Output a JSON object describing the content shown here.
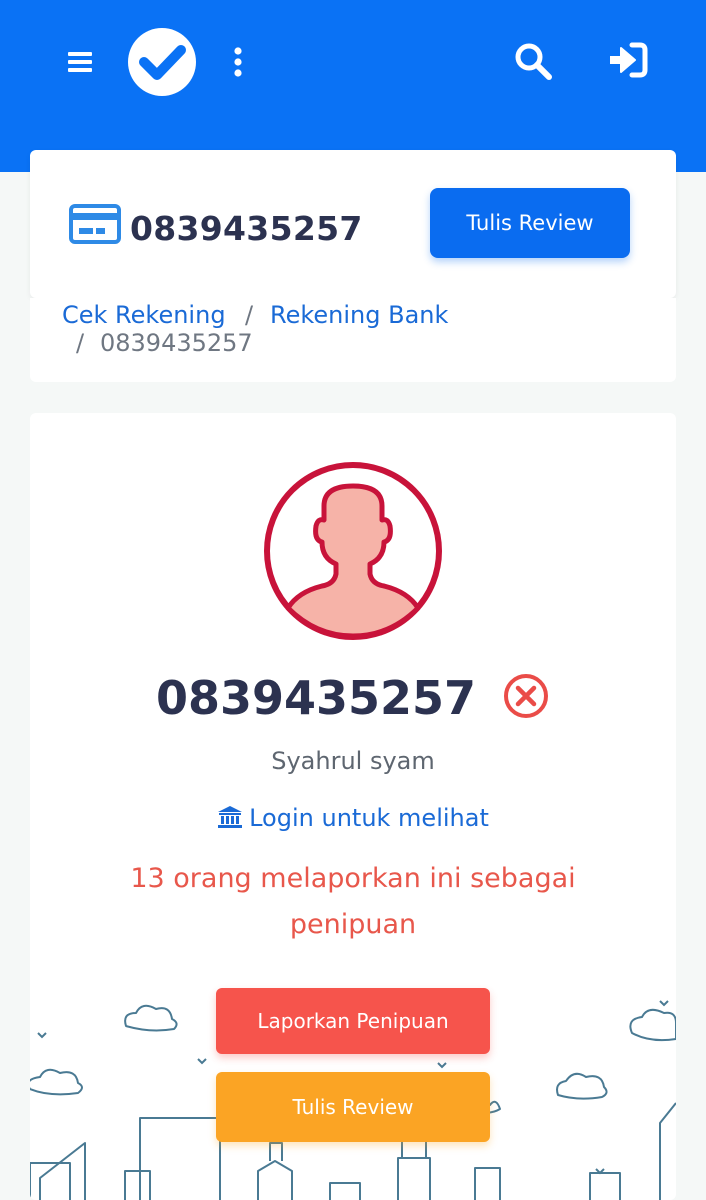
{
  "header": {
    "menu_icon": "hamburger-icon",
    "logo_icon": "check-circle-logo",
    "more_icon": "vertical-dots-icon",
    "search_icon": "search-icon",
    "login_icon": "sign-in-icon",
    "background_color": "#0a72f5"
  },
  "account": {
    "icon": "credit-card-icon",
    "number": "0839435257",
    "write_review_label": "Tulis Review"
  },
  "breadcrumb": {
    "items": [
      "Cek Rekening",
      "Rekening Bank"
    ],
    "separator": "/",
    "current": "0839435257"
  },
  "profile": {
    "avatar_icon": "user-avatar-icon",
    "number": "0839435257",
    "status_icon": "x-circle-icon",
    "owner_name": "Syahrul syam",
    "bank_icon": "bank-icon",
    "login_text": "Login untuk melihat",
    "report_text": "13 orang melaporkan ini sebagai penipuan",
    "report_button_label": "Laporkan Penipuan",
    "review_button_label": "Tulis Review",
    "colors": {
      "primary": "#0a6cf0",
      "danger": "#f6544c",
      "warning": "#fba424",
      "report_text": "#e8574b",
      "avatar_stroke": "#c8133a"
    }
  }
}
